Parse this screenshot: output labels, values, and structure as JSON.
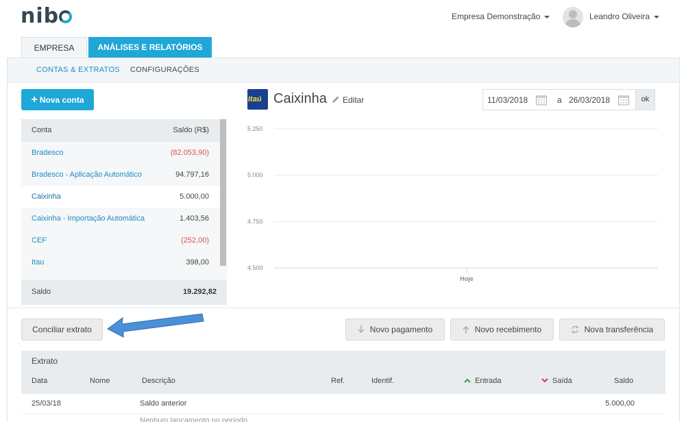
{
  "header": {
    "logo": "nibo",
    "company": "Empresa Demonstração",
    "user": "Leandro Oliveira"
  },
  "tabs": {
    "empresa": "EMPRESA",
    "analises": "ANÁLISES E RELATÓRIOS"
  },
  "subnav": {
    "contas": "CONTAS & EXTRATOS",
    "config": "CONFIGURAÇÕES"
  },
  "new_account_label": "Nova conta",
  "accounts": {
    "col_conta": "Conta",
    "col_saldo": "Saldo (R$)",
    "rows": [
      {
        "name": "Bradesco",
        "value": "(82.053,90)"
      },
      {
        "name": "Bradesco - Aplicação Automático",
        "value": "94.797,16"
      },
      {
        "name": "Caixinha",
        "value": "5.000,00"
      },
      {
        "name": "Caixinha - Importação Automática",
        "value": "1.403,56"
      },
      {
        "name": "CEF",
        "value": "(252,00)"
      },
      {
        "name": "Itau",
        "value": "398,00"
      }
    ],
    "total_label": "Saldo",
    "total_value": "19.292,82"
  },
  "selected_account": {
    "bank_logo_text": "Itaú",
    "title": "Caixinha",
    "edit_label": "Editar"
  },
  "date_range": {
    "from": "11/03/2018",
    "sep": "a",
    "to": "26/03/2018",
    "ok": "ok"
  },
  "chart_data": {
    "type": "line",
    "y_ticks": [
      "5.250",
      "5.000",
      "4.750",
      "4.500"
    ],
    "ylim": [
      4500,
      5250
    ],
    "x_label_today": "Hoje",
    "series": []
  },
  "actions": {
    "conciliar": "Conciliar extrato",
    "pagamento": "Novo pagamento",
    "recebimento": "Novo recebimento",
    "transferencia": "Nova transferência"
  },
  "extrato": {
    "title": "Extrato",
    "columns": {
      "data": "Data",
      "nome": "Nome",
      "descricao": "Descrição",
      "ref": "Ref.",
      "identif": "Identif.",
      "entrada": "Entrada",
      "saida": "Saída",
      "saldo": "Saldo"
    },
    "rows": [
      {
        "data": "25/03/18",
        "descricao": "Saldo anterior",
        "saldo": "5.000,00"
      }
    ],
    "empty_text": "Nenhum lançamento no período"
  },
  "colors": {
    "accent": "#1ea7d7",
    "negative": "#d9534f",
    "bank_blue": "#1b3f8f",
    "bank_yellow": "#f5e12c",
    "entrada": "#2e9e4f",
    "saida": "#d9363e",
    "annotation": "#4a90d9"
  }
}
